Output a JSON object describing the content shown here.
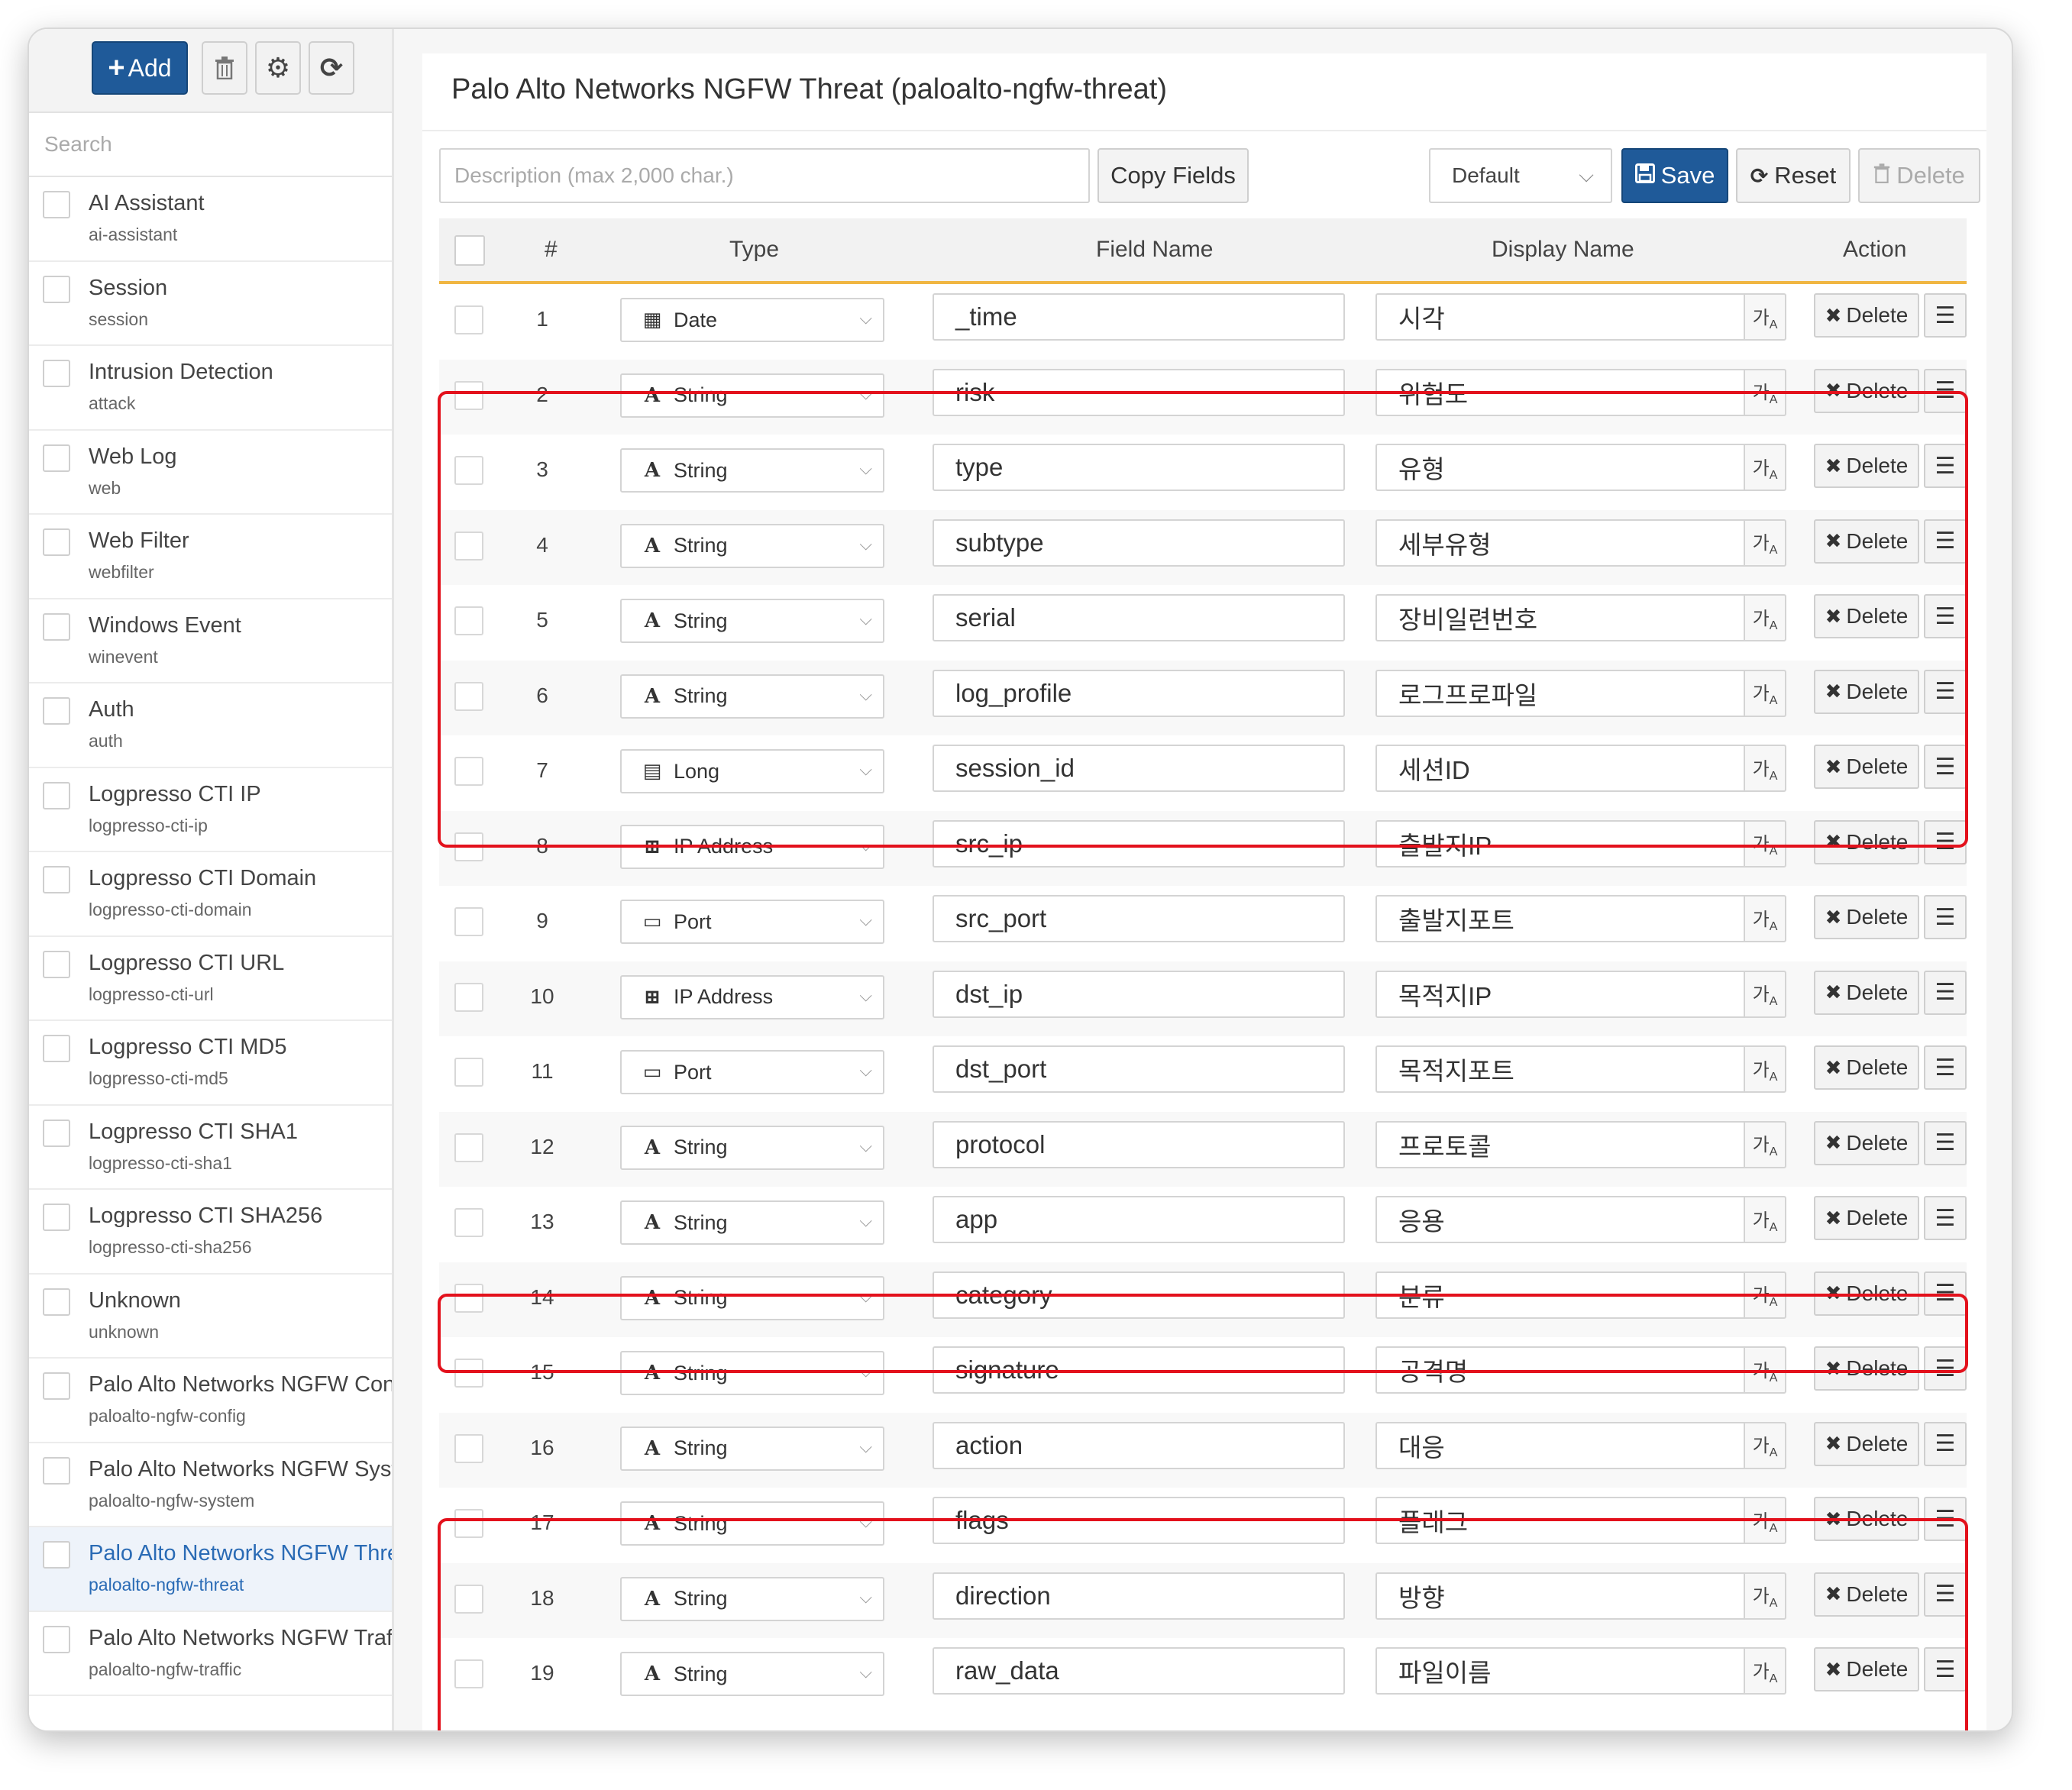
{
  "sidebar": {
    "add_label": "Add",
    "search_placeholder": "Search",
    "items": [
      {
        "name": "AI Assistant",
        "id": "ai-assistant"
      },
      {
        "name": "Session",
        "id": "session"
      },
      {
        "name": "Intrusion Detection",
        "id": "attack"
      },
      {
        "name": "Web Log",
        "id": "web"
      },
      {
        "name": "Web Filter",
        "id": "webfilter"
      },
      {
        "name": "Windows Event",
        "id": "winevent"
      },
      {
        "name": "Auth",
        "id": "auth"
      },
      {
        "name": "Logpresso CTI IP",
        "id": "logpresso-cti-ip"
      },
      {
        "name": "Logpresso CTI Domain",
        "id": "logpresso-cti-domain"
      },
      {
        "name": "Logpresso CTI URL",
        "id": "logpresso-cti-url"
      },
      {
        "name": "Logpresso CTI MD5",
        "id": "logpresso-cti-md5"
      },
      {
        "name": "Logpresso CTI SHA1",
        "id": "logpresso-cti-sha1"
      },
      {
        "name": "Logpresso CTI SHA256",
        "id": "logpresso-cti-sha256"
      },
      {
        "name": "Unknown",
        "id": "unknown"
      },
      {
        "name": "Palo Alto Networks NGFW Config",
        "id": "paloalto-ngfw-config"
      },
      {
        "name": "Palo Alto Networks NGFW System",
        "id": "paloalto-ngfw-system"
      },
      {
        "name": "Palo Alto Networks NGFW Threat",
        "id": "paloalto-ngfw-threat",
        "active": true
      },
      {
        "name": "Palo Alto Networks NGFW Traffic",
        "id": "paloalto-ngfw-traffic"
      }
    ]
  },
  "main": {
    "title": "Palo Alto Networks NGFW Threat (paloalto-ngfw-threat)",
    "description_placeholder": "Description (max 2,000 char.)",
    "copy_fields_label": "Copy Fields",
    "profile_select": "Default",
    "save_label": "Save",
    "reset_label": "Reset",
    "delete_label": "Delete"
  },
  "table": {
    "headers": {
      "num": "#",
      "type": "Type",
      "field": "Field Name",
      "display": "Display Name",
      "action": "Action"
    },
    "row_delete_label": "Delete",
    "rows": [
      {
        "num": "1",
        "type": "Date",
        "icon": "calendar-icon",
        "field": "_time",
        "display": "시각"
      },
      {
        "num": "2",
        "type": "String",
        "icon": "string-icon",
        "field": "risk",
        "display": "위험도"
      },
      {
        "num": "3",
        "type": "String",
        "icon": "string-icon",
        "field": "type",
        "display": "유형"
      },
      {
        "num": "4",
        "type": "String",
        "icon": "string-icon",
        "field": "subtype",
        "display": "세부유형"
      },
      {
        "num": "5",
        "type": "String",
        "icon": "string-icon",
        "field": "serial",
        "display": "장비일련번호"
      },
      {
        "num": "6",
        "type": "String",
        "icon": "string-icon",
        "field": "log_profile",
        "display": "로그프로파일"
      },
      {
        "num": "7",
        "type": "Long",
        "icon": "calculator-icon",
        "field": "session_id",
        "display": "세션ID"
      },
      {
        "num": "8",
        "type": "IP Address",
        "icon": "network-icon",
        "field": "src_ip",
        "display": "출발지IP"
      },
      {
        "num": "9",
        "type": "Port",
        "icon": "port-icon",
        "field": "src_port",
        "display": "출발지포트"
      },
      {
        "num": "10",
        "type": "IP Address",
        "icon": "network-icon",
        "field": "dst_ip",
        "display": "목적지IP"
      },
      {
        "num": "11",
        "type": "Port",
        "icon": "port-icon",
        "field": "dst_port",
        "display": "목적지포트"
      },
      {
        "num": "12",
        "type": "String",
        "icon": "string-icon",
        "field": "protocol",
        "display": "프로토콜"
      },
      {
        "num": "13",
        "type": "String",
        "icon": "string-icon",
        "field": "app",
        "display": "응용"
      },
      {
        "num": "14",
        "type": "String",
        "icon": "string-icon",
        "field": "category",
        "display": "분류"
      },
      {
        "num": "15",
        "type": "String",
        "icon": "string-icon",
        "field": "signature",
        "display": "공격명"
      },
      {
        "num": "16",
        "type": "String",
        "icon": "string-icon",
        "field": "action",
        "display": "대응"
      },
      {
        "num": "17",
        "type": "String",
        "icon": "string-icon",
        "field": "flags",
        "display": "플래그"
      },
      {
        "num": "18",
        "type": "String",
        "icon": "string-icon",
        "field": "direction",
        "display": "방향"
      },
      {
        "num": "19",
        "type": "String",
        "icon": "string-icon",
        "field": "raw_data",
        "display": "파일이름"
      }
    ]
  },
  "colors": {
    "primary": "#1f5a99",
    "highlight": "#e3111c",
    "header_accent": "#f0b642"
  }
}
